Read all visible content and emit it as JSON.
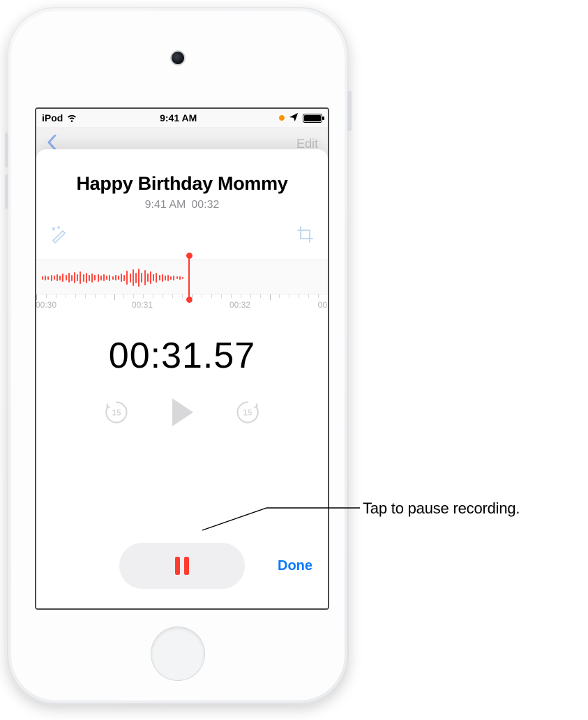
{
  "statusbar": {
    "carrier": "iPod",
    "time": "9:41 AM"
  },
  "backdrop": {
    "edit_label": "Edit"
  },
  "recording": {
    "title": "Happy Birthday Mommy",
    "time_created": "9:41 AM",
    "duration_short": "00:32",
    "elapsed_timer": "00:31.57",
    "ruler": {
      "l0": "00:30",
      "l1": "00:31",
      "l2": "00:32",
      "l3": "00:"
    }
  },
  "controls": {
    "skip_back_label": "15",
    "skip_fwd_label": "15",
    "done_label": "Done"
  },
  "callout": {
    "text": "Tap to pause recording."
  },
  "colors": {
    "accent_blue": "#0a7aff",
    "record_red": "#ff3b30",
    "orange_indicator": "#ff9500",
    "muted_gray": "#8e8e93"
  }
}
